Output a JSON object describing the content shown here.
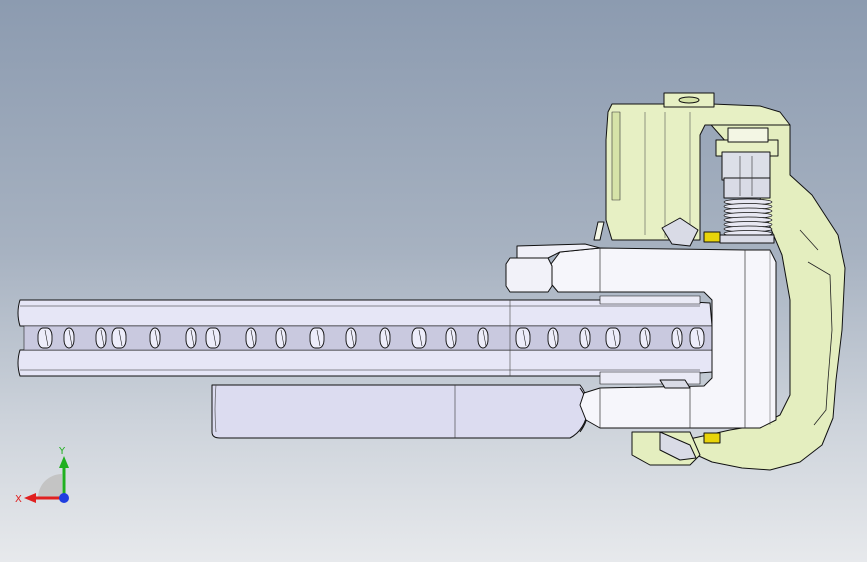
{
  "viewport": {
    "background_top": "#8c9bb0",
    "background_bottom": "#e7e9ec"
  },
  "colors": {
    "housing_green": "#e2edbe",
    "rotor_lavender": "#e4e4f4",
    "caliper_white": "#f7f7fb",
    "nut_gray": "#d9dbe6",
    "accent_yellow": "#e8d40a",
    "edge": "#111111"
  },
  "triad": {
    "x_label": "X",
    "y_label": "Y",
    "x_color": "#e02020",
    "y_color": "#20b020",
    "z_color": "#1f3ee0"
  },
  "parts": {
    "rotor": "brake-disc-rotor",
    "hub": "hub-hat",
    "caliper": "brake-caliper",
    "housing": "caliper-housing",
    "bolt": "mounting-bolt",
    "spring": "coil-spring"
  }
}
